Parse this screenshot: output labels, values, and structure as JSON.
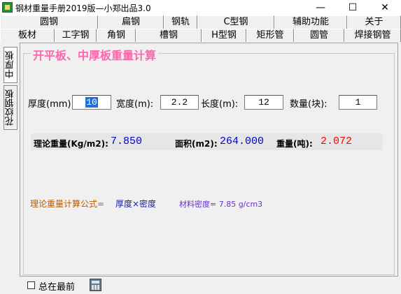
{
  "window": {
    "title": "钢材重量手册2019版—小郑出品3.0",
    "min_glyph": "—",
    "max_glyph": "☐",
    "close_glyph": "✕"
  },
  "tabs_row1": [
    "圆钢",
    "扁钢",
    "钢轨",
    "C型钢",
    "辅助功能",
    "关于"
  ],
  "tabs_row2": [
    "板材",
    "工字钢",
    "角钢",
    "槽钢",
    "H型钢",
    "矩形管",
    "圆管",
    "焊接钢管"
  ],
  "side_tabs": [
    "中厚板",
    "花纹钢板"
  ],
  "group_title": "开平板、中厚板重量计算",
  "inputs": {
    "thickness": {
      "label": "厚度(mm):",
      "value": "10"
    },
    "width": {
      "label": "宽度(m):",
      "value": "2.2"
    },
    "length": {
      "label": "长度(m):",
      "value": "12"
    },
    "quantity": {
      "label": "数量(块):",
      "value": "1"
    }
  },
  "results": {
    "theoretical_weight": {
      "label": "理论重量(Kg/m2):",
      "value": "7.850"
    },
    "area": {
      "label": "面积(m2):",
      "value": "264.000"
    },
    "weight": {
      "label": "重量(吨):",
      "value": "2.072"
    }
  },
  "formula": {
    "label": "理论重量计算公式=",
    "expression": "厚度×密度",
    "density": "材料密度= 7.85 g/cm3"
  },
  "bottom": {
    "stay_on_top_label": "总在最前",
    "stay_on_top_checked": false
  },
  "colors": {
    "title_pink": "#ff66aa",
    "value_blue": "#0000cc",
    "value_red": "#ff0000",
    "formula_orange": "#b85c00",
    "formula_blue": "#1a1aa6",
    "density_purple": "#6633cc"
  }
}
